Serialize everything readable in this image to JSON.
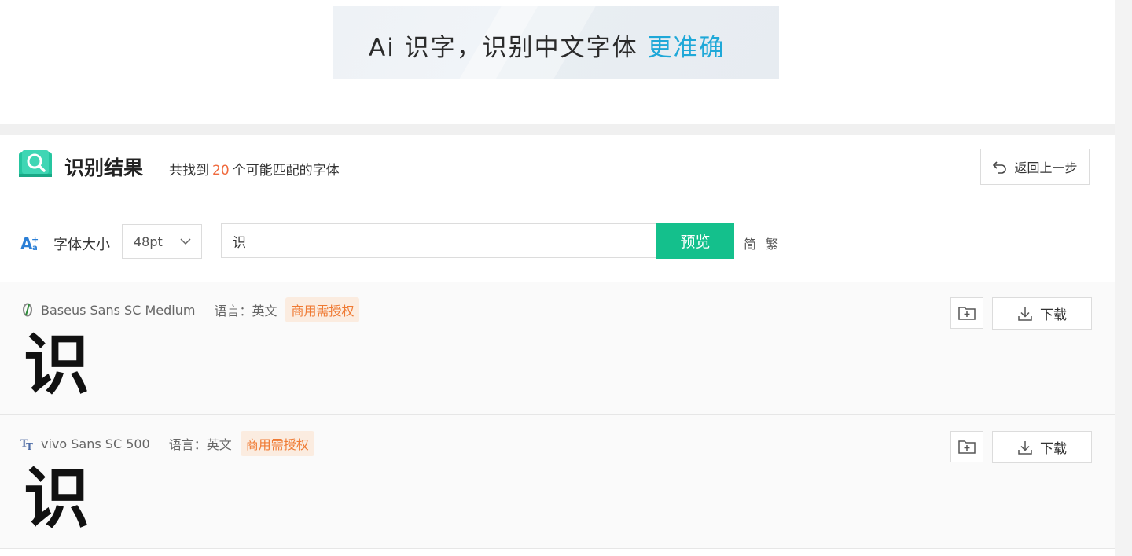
{
  "banner": {
    "text_main": "Ai 识字，识别中文字体",
    "text_accent": "更准确",
    "accent_color": "#1fa8d8"
  },
  "result_header": {
    "title": "识别结果",
    "summary_prefix": "共找到",
    "count": "20",
    "summary_suffix": "个可能匹配的字体",
    "back_label": "返回上一步"
  },
  "toolbar": {
    "size_label": "字体大小",
    "size_value": "48pt",
    "input_value": "识",
    "preview_label": "预览",
    "simplified_label": "简",
    "traditional_label": "繁",
    "primary_color": "#14c08c"
  },
  "fonts": [
    {
      "name": "Baseus Sans SC Medium",
      "language": "语言：英文",
      "license": "商用需授权",
      "sample": "识",
      "download_label": "下载",
      "icon": "font-o-icon"
    },
    {
      "name": "vivo Sans SC 500",
      "language": "语言：英文",
      "license": "商用需授权",
      "sample": "识",
      "download_label": "下载",
      "icon": "font-tt-icon"
    }
  ]
}
